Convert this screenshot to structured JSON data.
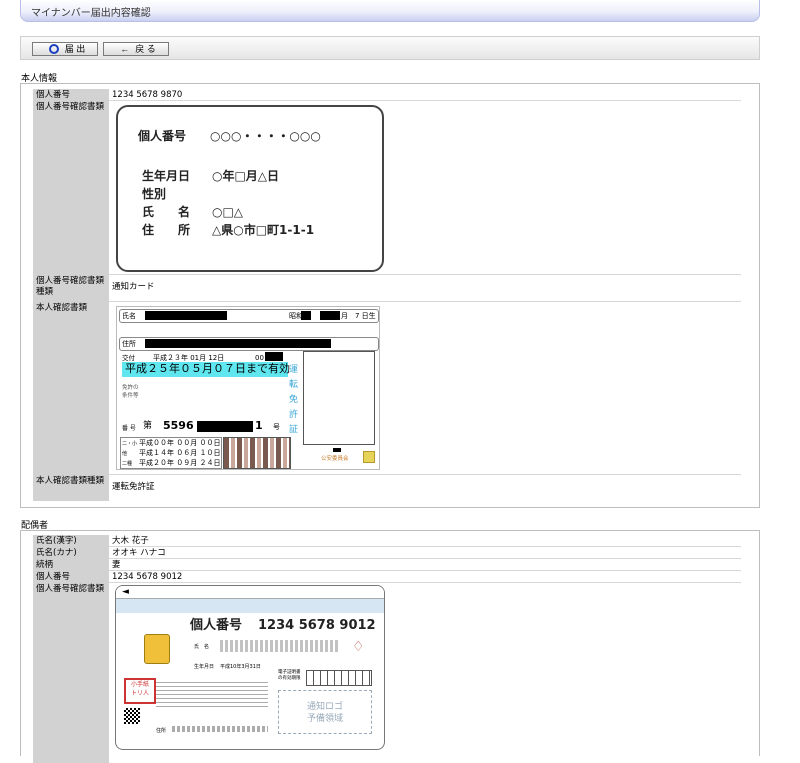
{
  "header": {
    "title": "マイナンバー届出内容確認"
  },
  "toolbar": {
    "submit_icon": "circle-icon",
    "submit_label": "届 出",
    "back_icon": "arrow-left-icon",
    "back_label": "戻 る"
  },
  "principal": {
    "section_label": "本人情報",
    "number_label": "個人番号",
    "number_value": "1234 5678 9870",
    "doc_label": "個人番号確認書類",
    "card": {
      "line1_label": "個人番号",
      "line1_value": "○○○・・・・○○○",
      "line2_label": "生年月日",
      "line2_value": "○年□月△日",
      "line3_label": "性別",
      "line4_label": "氏　　名",
      "line4_value": "○□△",
      "line5_label": "住　　所",
      "line5_value": "△県○市□町1-1-1"
    },
    "doc_type_label": "個人番号確認書類種類",
    "doc_type_value": "通知カード",
    "id_doc_label": "本人確認書類",
    "license": {
      "name_label": "氏名",
      "birth_prefix": "昭和",
      "birth_suffix": "月　7 日生",
      "address_label": "住所",
      "issue_label": "交付",
      "issue_value": "平成２３年 01月 12日",
      "issue_suffix": "00",
      "valid_text": "平成２５年０５月０７日まで有効",
      "cond_label1": "免許の",
      "cond_label2": "条件等",
      "number_label": "番 号",
      "number_prefix": "第",
      "number_value": "5596",
      "number_suffix": "1",
      "number_end": "号",
      "row1_label": "二・小",
      "row1_value": "平成００年 ００月 ００日",
      "row2_label": "他",
      "row2_value": "平成１４年 ０６月 １０日",
      "row3_label": "二種",
      "row3_value": "平成２０年 ０９月 ２４日",
      "side_text": [
        "運",
        "転",
        "免",
        "許",
        "証"
      ],
      "issuer": "公安委員会"
    },
    "id_doc_type_label": "本人確認書類種類",
    "id_doc_type_value": "運転免許証"
  },
  "spouse": {
    "section_label": "配偶者",
    "kanji_label": "氏名(漢字)",
    "kanji_value": "大木 花子",
    "kana_label": "氏名(カナ)",
    "kana_value": "オオキ ハナコ",
    "relation_label": "続柄",
    "relation_value": "妻",
    "number_label": "個人番号",
    "number_value": "1234 5678 9012",
    "doc_label": "個人番号確認書類",
    "card": {
      "number_label": "個人番号",
      "number_value": "1234 5678 9012",
      "name_label": "氏　名",
      "birth_label": "生年月日",
      "birth_value": "平成10年3月31日",
      "cert_label1": "電子証明書",
      "cert_label2": "の有効期限",
      "notice_line1": "通知ロゴ",
      "notice_line2": "予備領域",
      "stamp_line1": "小手紙",
      "stamp_line2": "トリ人",
      "address_label": "住所"
    }
  }
}
